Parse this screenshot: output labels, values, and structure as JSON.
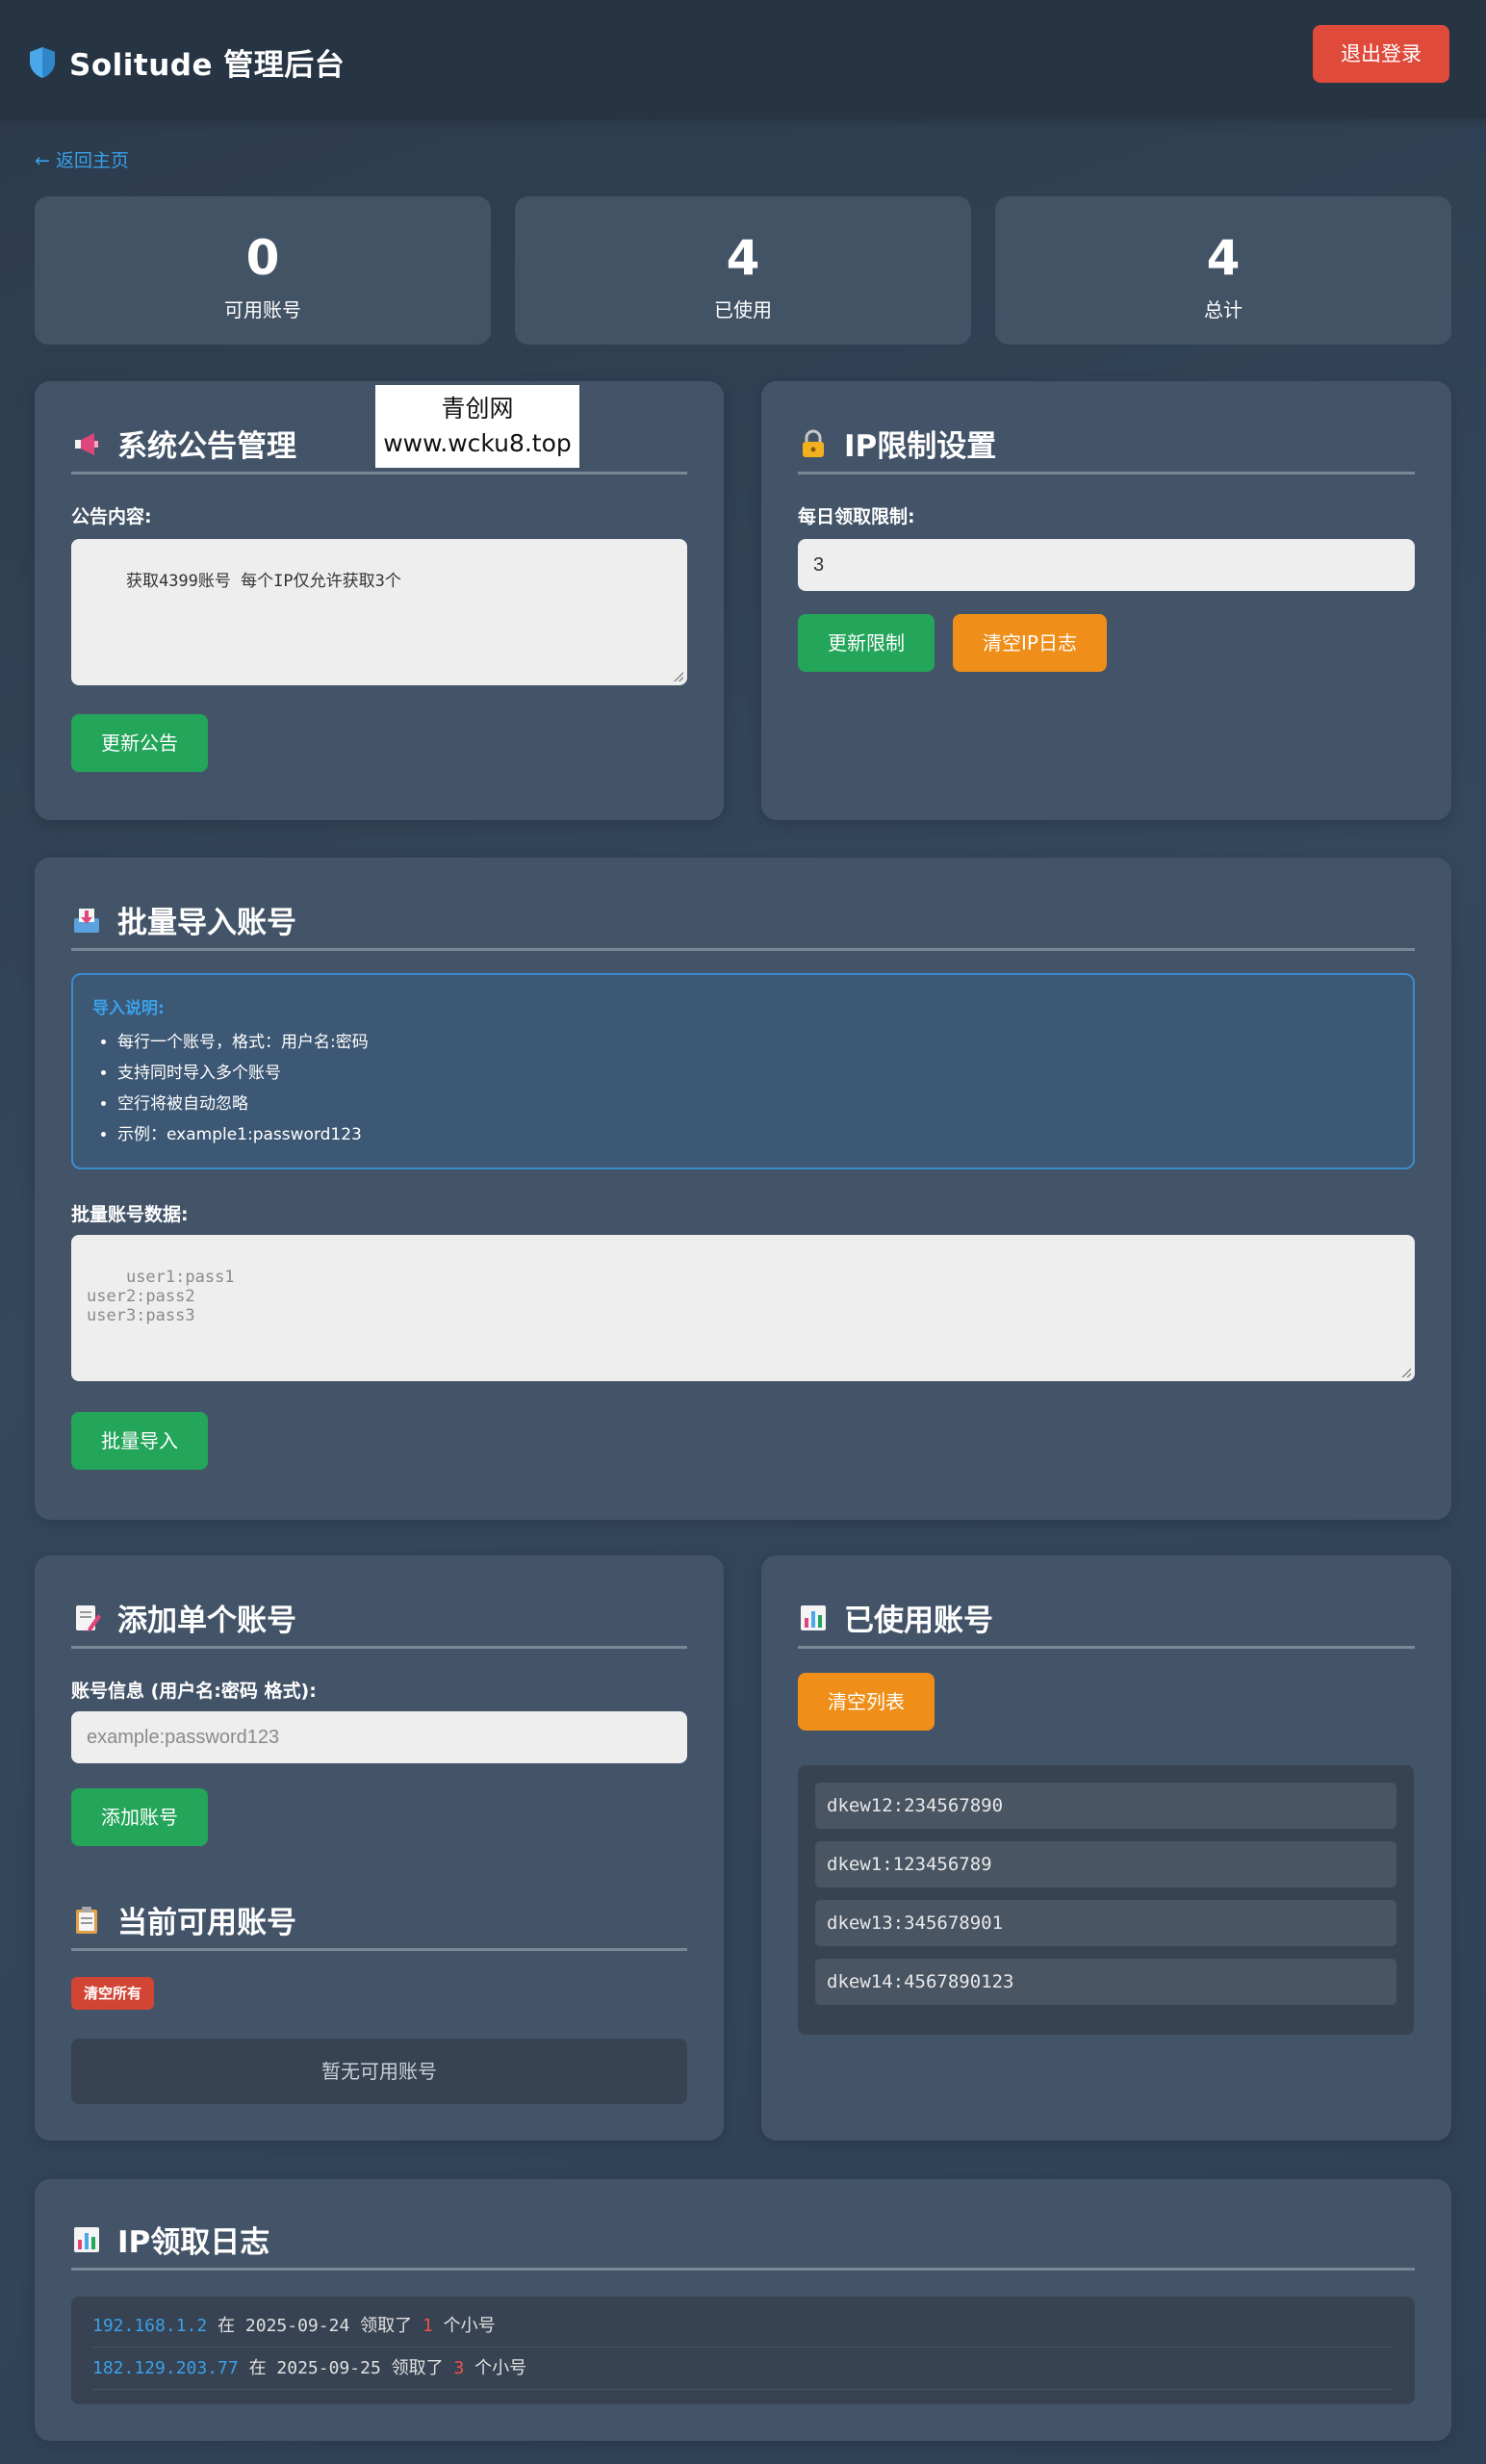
{
  "header": {
    "title": "Solitude 管理后台",
    "logout_label": "退出登录"
  },
  "nav": {
    "back_label": "← 返回主页"
  },
  "stats": [
    {
      "value": "0",
      "label": "可用账号"
    },
    {
      "value": "4",
      "label": "已使用"
    },
    {
      "value": "4",
      "label": "总计"
    }
  ],
  "watermark": {
    "line1": "青创网",
    "line2": "www.wcku8.top"
  },
  "announcement": {
    "title": "系统公告管理",
    "label": "公告内容:",
    "content": "获取4399账号 每个IP仅允许获取3个",
    "button": "更新公告"
  },
  "ip_limit": {
    "title": "IP限制设置",
    "label": "每日领取限制:",
    "value": "3",
    "update_button": "更新限制",
    "clear_button": "清空IP日志"
  },
  "batch_import": {
    "title": "批量导入账号",
    "info_title": "导入说明:",
    "info_items": [
      "每行一个账号，格式：用户名:密码",
      "支持同时导入多个账号",
      "空行将被自动忽略",
      "示例：example1:password123"
    ],
    "label": "批量账号数据:",
    "placeholder": "user1:pass1\nuser2:pass2\nuser3:pass3",
    "button": "批量导入"
  },
  "add_single": {
    "title": "添加单个账号",
    "label": "账号信息 (用户名:密码 格式):",
    "placeholder": "example:password123",
    "button": "添加账号"
  },
  "available": {
    "title": "当前可用账号",
    "clear_all": "清空所有",
    "empty_text": "暂无可用账号"
  },
  "used_accounts": {
    "title": "已使用账号",
    "clear_button": "清空列表",
    "items": [
      "dkew12:234567890",
      "dkew1:123456789",
      "dkew13:345678901",
      "dkew14:4567890123"
    ]
  },
  "ip_log": {
    "title": "IP领取日志",
    "rows": [
      {
        "ip": "192.168.1.2",
        "on": "在",
        "date": "2025-09-24",
        "took": "领取了",
        "count": "1",
        "unit": "个小号"
      },
      {
        "ip": "182.129.203.77",
        "on": "在",
        "date": "2025-09-25",
        "took": "领取了",
        "count": "3",
        "unit": "个小号"
      }
    ]
  },
  "colors": {
    "accent_blue": "#3aa0ea",
    "green": "#23a55a",
    "orange": "#ef8f1a",
    "red": "#e04a3b"
  }
}
